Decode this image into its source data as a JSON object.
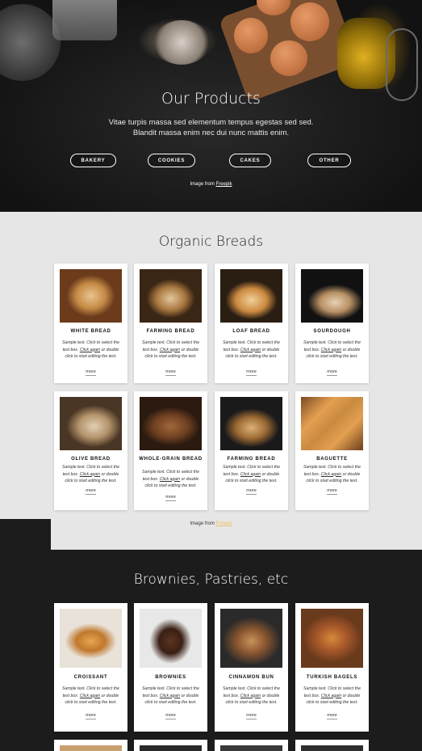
{
  "hero": {
    "title": "Our Products",
    "subtitle_line1": "Vitae turpis massa sed elementum tempus egestas sed sed.",
    "subtitle_line2": "Blandit massa enim nec dui nunc mattis enim.",
    "buttons": [
      "BAKERY",
      "COOKIES",
      "CAKES",
      "OTHER"
    ],
    "credit_prefix": "Image from",
    "credit_link": "Freepik"
  },
  "organic": {
    "title": "Organic Breads",
    "credit_prefix": "Image from",
    "credit_link": "Freepik",
    "cards": [
      {
        "name": "WHITE BREAD",
        "more": "more"
      },
      {
        "name": "FARMING BREAD",
        "more": "more"
      },
      {
        "name": "LOAF BREAD",
        "more": "more"
      },
      {
        "name": "SOURDOUGH",
        "more": "more"
      },
      {
        "name": "OLIVE BREAD",
        "more": "more"
      },
      {
        "name": "WHOLE-GRAIN BREAD",
        "more": "more"
      },
      {
        "name": "FARMING BREAD",
        "more": "more"
      },
      {
        "name": "BAGUETTE",
        "more": "more"
      }
    ]
  },
  "brownies": {
    "title": "Brownies, Pastries, etc",
    "cards": [
      {
        "name": "CROISSANT",
        "more": "more"
      },
      {
        "name": "BROWNIES",
        "more": "more"
      },
      {
        "name": "CINNAMON BUN",
        "more": "more"
      },
      {
        "name": "TURKISH BAGELS",
        "more": "more"
      }
    ]
  },
  "card_text": {
    "line1": "Sample text. Click to select the",
    "line2_a": "text box. ",
    "line2_link": "Click again",
    "line2_b": " or double",
    "line3": "click to start editing the text."
  }
}
